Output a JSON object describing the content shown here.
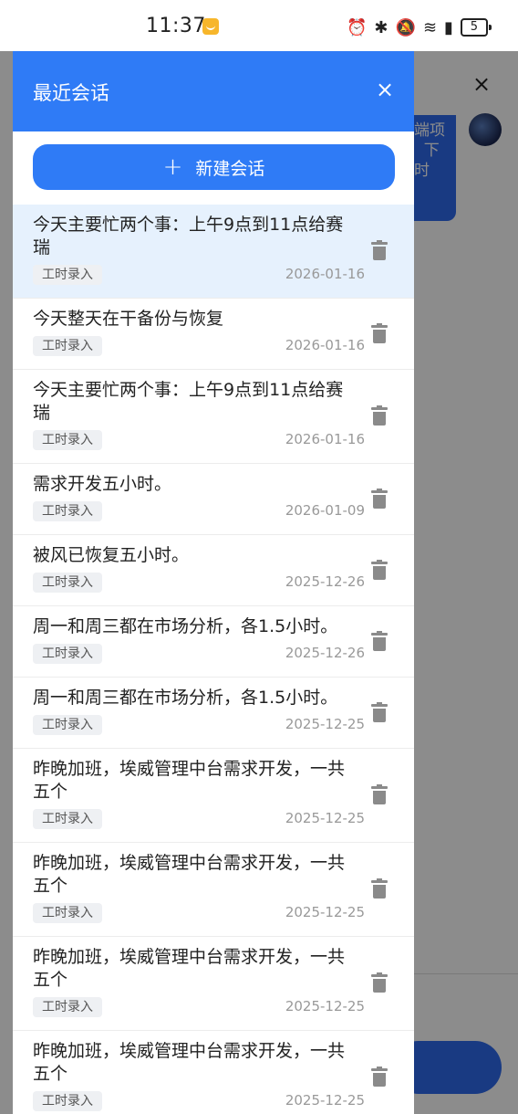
{
  "status_bar": {
    "time": "11:37",
    "battery": "5",
    "icons": [
      "alarm-icon",
      "bluetooth-icon",
      "mute-icon",
      "wifi-icon",
      "sim-icon",
      "battery-icon"
    ]
  },
  "background": {
    "bubble_text": "端项\n  下\n时",
    "close_symbol": "×"
  },
  "drawer": {
    "title": "最近会话",
    "close_symbol": "×",
    "new_chat_label": "新建会话",
    "new_chat_plus": "+"
  },
  "sessions": [
    {
      "title": "今天主要忙两个事：上午9点到11点给赛瑞",
      "tag": "工时录入",
      "date": "2026-01-16",
      "active": true
    },
    {
      "title": "今天整天在干备份与恢复",
      "tag": "工时录入",
      "date": "2026-01-16",
      "active": false
    },
    {
      "title": "今天主要忙两个事：上午9点到11点给赛瑞",
      "tag": "工时录入",
      "date": "2026-01-16",
      "active": false
    },
    {
      "title": "需求开发五小时。",
      "tag": "工时录入",
      "date": "2026-01-09",
      "active": false
    },
    {
      "title": "被风已恢复五小时。",
      "tag": "工时录入",
      "date": "2025-12-26",
      "active": false
    },
    {
      "title": "周一和周三都在市场分析，各1.5小时。",
      "tag": "工时录入",
      "date": "2025-12-26",
      "active": false
    },
    {
      "title": "周一和周三都在市场分析，各1.5小时。",
      "tag": "工时录入",
      "date": "2025-12-25",
      "active": false
    },
    {
      "title": "昨晚加班，埃威管理中台需求开发，一共五个",
      "tag": "工时录入",
      "date": "2025-12-25",
      "active": false
    },
    {
      "title": "昨晚加班，埃威管理中台需求开发，一共五个",
      "tag": "工时录入",
      "date": "2025-12-25",
      "active": false
    },
    {
      "title": "昨晚加班，埃威管理中台需求开发，一共五个",
      "tag": "工时录入",
      "date": "2025-12-25",
      "active": false
    },
    {
      "title": "昨晚加班，埃威管理中台需求开发，一共五个",
      "tag": "工时录入",
      "date": "2025-12-25",
      "active": false
    }
  ],
  "colors": {
    "accent": "#2f7bf6",
    "active_row": "#e6f1fd"
  }
}
